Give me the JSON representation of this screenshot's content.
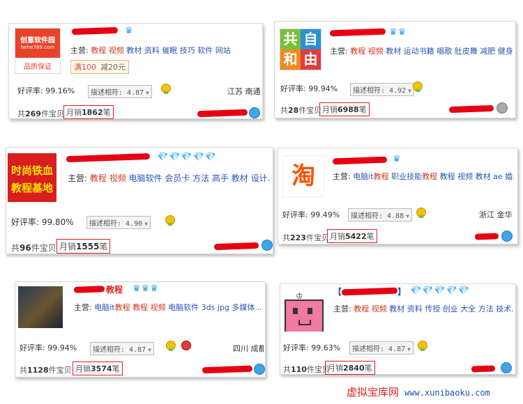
{
  "cards": [
    {
      "main_label": "主营:",
      "main_red": "教程 视频",
      "main_blue": "教材 资料 催眠 技巧 软件 网站",
      "logo_text": "创意软件园",
      "logo_sub": "hehe789.com",
      "logo_badge": "品质保证",
      "promo_full": "满100",
      "promo_off": "减20元",
      "rating_label": "好评率:",
      "rating_value": "99.16%",
      "desc_text": "描述相符: 4.87",
      "location": "江苏 南通",
      "count_pre": "共",
      "count_num": "269",
      "count_post": "件宝贝",
      "sales_pre": "月销",
      "sales_num": "1862",
      "sales_post": "笔"
    },
    {
      "main_label": "主营:",
      "main_red": "教程 视频",
      "main_blue": "教材 运动书籍 唱歌 肚皮舞 减肥 健身",
      "logo_chars": [
        "共",
        "自",
        "和",
        "由"
      ],
      "rating_label": "好评率:",
      "rating_value": "99.94%",
      "desc_text": "描述相符: 4.92",
      "count_pre": "共",
      "count_num": "28",
      "count_post": "件宝贝",
      "sales_pre": "月销",
      "sales_num": "6988",
      "sales_post": "笔"
    },
    {
      "main_label": "主营:",
      "main_red": "教程 视频",
      "main_blue": "电脑软件 会员卡 方法 高手 教材 设计...",
      "logo_line1": "时尚铁血",
      "logo_line2": "教程基地",
      "rating_label": "好评率:",
      "rating_value": "99.80%",
      "desc_text": "描述相符: 4.90",
      "count_pre": "共",
      "count_num": "96",
      "count_post": "件宝贝",
      "sales_pre": "月销",
      "sales_num": "1555",
      "sales_post": "笔"
    },
    {
      "main_label": "主营:",
      "main_blue1": "电脑it",
      "main_red": "教程",
      "main_blue": "职业技能",
      "main_red2": "教程",
      "main_blue2": "教程 视频 教材 ae 婚...",
      "logo_text": "淘",
      "rating_label": "好评率:",
      "rating_value": "99.49%",
      "desc_text": "描述相符: 4.88",
      "location": "浙江 金华",
      "count_pre": "共",
      "count_num": "223",
      "count_post": "件宝贝",
      "sales_pre": "月销",
      "sales_num": "5422",
      "sales_post": "笔"
    },
    {
      "title_suffix": "教程",
      "main_label": "主营:",
      "main_blue1": "电脑it",
      "main_red": "教程 教程 视频",
      "main_blue": "电脑软件 3ds jpg 多媒体...",
      "rating_label": "好评率:",
      "rating_value": "99.94%",
      "desc_text": "描述相符: 4.87",
      "location": "四川 成都",
      "count_pre": "共",
      "count_num": "1128",
      "count_post": "件宝贝",
      "sales_pre": "月销",
      "sales_num": "3574",
      "sales_post": "笔"
    },
    {
      "title_prefix": "【",
      "title_suffix": "】",
      "main_label": "主营:",
      "main_red": "教程 视频",
      "main_blue": "教材 资料 传授 创业 大全 方法 技术...",
      "rating_label": "好评率:",
      "rating_value": "99.63%",
      "desc_text": "描述相符: 4.87",
      "count_pre": "共",
      "count_num": "110",
      "count_post": "件宝贝",
      "sales_pre": "月销",
      "sales_num": "2840",
      "sales_post": "笔"
    }
  ],
  "watermark": {
    "brand": "虚拟宝库网",
    "url": "www.xunibaoku.com"
  },
  "colors": {
    "accent_red": "#e60012",
    "link_blue": "#2a55b8",
    "keyword_red": "#d03a1a",
    "sales_border": "#d81e1e"
  }
}
